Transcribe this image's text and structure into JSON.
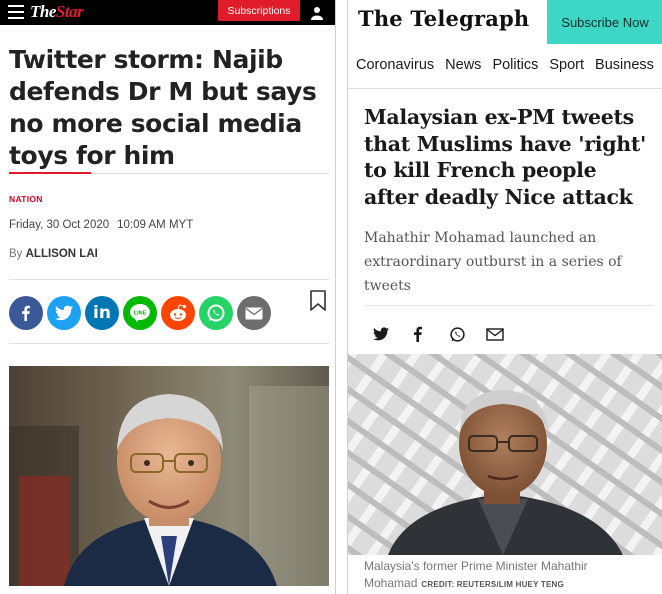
{
  "left_site": {
    "logo_prefix": "The",
    "logo_suffix": "Star",
    "subscribe_label": "Subscriptions",
    "headline": "Twitter storm: Najib defends Dr M but says no more social media toys for him",
    "section": "NATION",
    "date": "Friday, 30 Oct 2020",
    "time": "10:09 AM MYT",
    "by_prefix": "By",
    "author": "ALLISON LAI",
    "share_icons": [
      {
        "name": "facebook-icon",
        "glyph": "f",
        "color": "#3b5998"
      },
      {
        "name": "twitter-icon",
        "glyph": "t",
        "color": "#1da1f2"
      },
      {
        "name": "linkedin-icon",
        "glyph": "in",
        "color": "#0077b5"
      },
      {
        "name": "line-icon",
        "glyph": "LINE",
        "color": "#00b900"
      },
      {
        "name": "reddit-icon",
        "glyph": "r",
        "color": "#ff4500"
      },
      {
        "name": "whatsapp-icon",
        "glyph": "w",
        "color": "#25d366"
      },
      {
        "name": "email-icon",
        "glyph": "@",
        "color": "#6d6d6d"
      }
    ],
    "accent_color": "#e01c2a"
  },
  "right_site": {
    "logo": "The Telegraph",
    "subscribe_label": "Subscribe Now",
    "nav": [
      "Coronavirus",
      "News",
      "Politics",
      "Sport",
      "Business"
    ],
    "headline": "Malaysian ex-PM tweets that Muslims have 'right' to kill French people after deadly Nice attack",
    "standfirst": "Mahathir Mohamad launched an extraordinary outburst in a series of tweets",
    "share_icons": [
      "twitter-icon",
      "facebook-icon",
      "whatsapp-icon",
      "email-icon"
    ],
    "caption": "Malaysia's former Prime Minister Mahathir Mohamad",
    "credit": "CREDIT: REUTERS/LIM HUEY TENG",
    "accent_color": "#3ed6c4"
  }
}
